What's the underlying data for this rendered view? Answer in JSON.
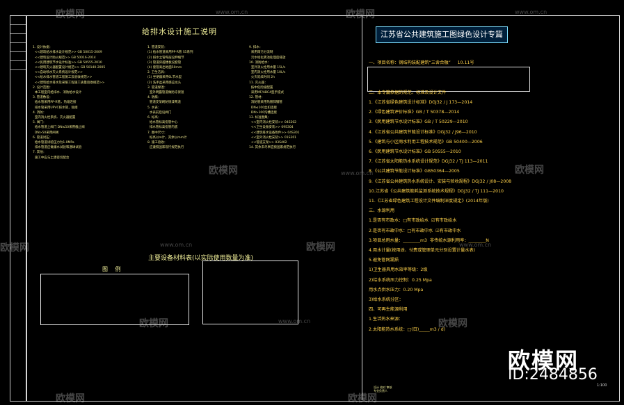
{
  "left_title": "给排水设计施工说明",
  "equipment_title": "主要设备材料表(以实际使用数量为准)",
  "legend_title": "图 例",
  "right_title": "江苏省公共建筑施工图绿色设计专篇",
  "right_lines": [
    "一、项目名称：钢结构装配建筑“三舍合融”     10.11号",
    "二、本专篇依据的规范、标准及设计文件",
    "1.《江苏省绿色建筑设计标准》DGJ32 / J 173—2014",
    "2.《绿色建筑评价标准》GB / T 50378—2014",
    "3.《民用建筑节水设计标准》GB / T 50229—2010",
    "4.《江苏省公共建筑节能设计标准》DGJ32 / J96—2010",
    "5.《建筑与小区雨水利用工程技术规范》GB 50400—2006",
    "6.《民用建筑节水设计标准》GB 50555—2010",
    "7.《江苏省太阳能热水系统设计规范》DGJ32 / TJ 113—2011",
    "8.《公共建筑节能设计标准》GB50364—2005",
    "9.《江苏省公共建筑热水系统设计、安装与验收规程》DGJ32 / J08—2008",
    "10.江苏省《公共建筑能耗监测系统技术规程》DGJ32 / TJ 111—2010",
    "11.《江苏省绿色建筑工程设计文件编制深度规定》(2014年版)",
    "三、水源利用",
    "1.是否有市政水：□有市政给水  ☑有市政给水",
    "2.是否有市政中水：□有市政中水  ☑有市政中水",
    "3.项目总用水量：________m3  非传统水源利用率：________N",
    "4.用水计量(按用途、付费或管理单元分别设置计量水表)",
    "5.避免管网漏损",
    "1)卫生器具用水效率等级：2级",
    "2)给水系统压力控制：0.25 Mpa",
    "用水点供水压力：0.20 Mpa",
    "3)给水系统分区：",
    "四、可再生能源利用",
    "1.生活热水来源：",
    "2.太阳能热水系统：□(日)_____m3 / d)"
  ],
  "right_values": {
    "sanitary_grade": "2",
    "pressure_1": "0.25",
    "pressure_2": "0.20",
    "standard": "CJ164",
    "unit_mpa": "Mpa"
  },
  "watermark_text": "欧模网",
  "watermark_url": "www.om.cn",
  "brand": "欧模网",
  "brand_id": "ID:2484856",
  "scale": "1:100"
}
